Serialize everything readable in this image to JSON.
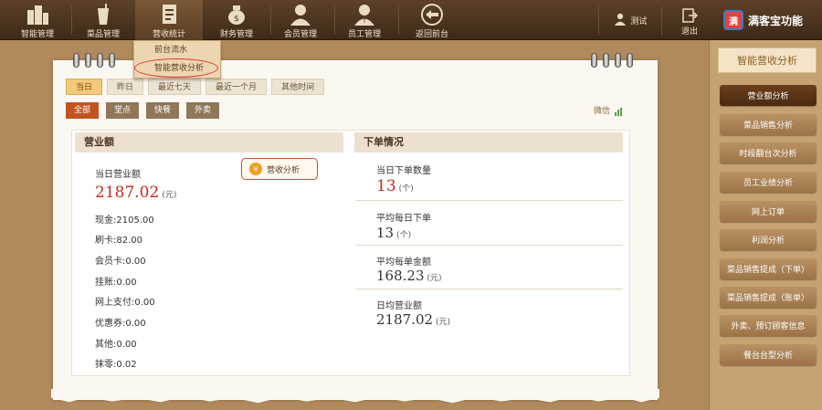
{
  "nav": {
    "items": [
      {
        "label": "智能管理",
        "icon": "buildings-icon"
      },
      {
        "label": "菜品管理",
        "icon": "drink-icon"
      },
      {
        "label": "营收统计",
        "icon": "document-icon",
        "active": true
      },
      {
        "label": "财务管理",
        "icon": "money-bag-icon"
      },
      {
        "label": "会员管理",
        "icon": "member-icon"
      },
      {
        "label": "员工管理",
        "icon": "staff-icon"
      },
      {
        "label": "返回前台",
        "icon": "back-arrow-icon"
      }
    ],
    "user_name": "测试",
    "logout_label": "退出",
    "brand_name": "满客宝功能",
    "brand_logo_char": "满"
  },
  "dropdown": {
    "items": [
      "前台流水",
      "智能营收分析"
    ]
  },
  "date_tabs": [
    "当日",
    "昨日",
    "最近七天",
    "最近一个月",
    "其他时间"
  ],
  "filter_tabs": [
    "全部",
    "堂点",
    "快餐",
    "外卖"
  ],
  "wx_link": "微信",
  "revenue": {
    "title": "营业额",
    "today_label": "当日营业额",
    "today_value": "2187.02",
    "unit": "(元)",
    "analysis_button": "营收分析",
    "analysis_icon": "¥",
    "breakdown": [
      {
        "label": "现金",
        "value": "2105.00"
      },
      {
        "label": "刷卡",
        "value": "82.00"
      },
      {
        "label": "会员卡",
        "value": "0.00"
      },
      {
        "label": "挂账",
        "value": "0.00"
      },
      {
        "label": "网上支付",
        "value": "0.00"
      },
      {
        "label": "优惠券",
        "value": "0.00"
      },
      {
        "label": "其他",
        "value": "0.00"
      },
      {
        "label": "抹零",
        "value": "0.02"
      }
    ]
  },
  "orders": {
    "title": "下单情况",
    "stats": [
      {
        "label": "当日下单数量",
        "value": "13",
        "unit": "(个)"
      },
      {
        "label": "平均每日下单",
        "value": "13",
        "unit": "(个)"
      },
      {
        "label": "平均每单金额",
        "value": "168.23",
        "unit": "(元)"
      },
      {
        "label": "日均营业额",
        "value": "2187.02",
        "unit": "(元)"
      }
    ]
  },
  "sidebar": {
    "title": "智能营收分析",
    "items": [
      "营业额分析",
      "菜品销售分析",
      "时段翻台次分析",
      "员工业绩分析",
      "网上订单",
      "利润分析",
      "菜品销售提成（下单）",
      "菜品销售提成（账单）",
      "外卖、预订顾客信息",
      "餐台台型分析"
    ]
  },
  "colors": {
    "accent_red": "#c62a1a",
    "active_orange": "#c25420",
    "active_date": "#f3c97a",
    "sidebar_active": "#4c2a10"
  }
}
